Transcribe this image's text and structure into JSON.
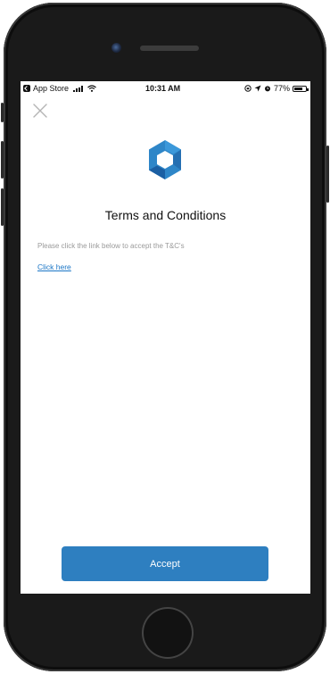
{
  "status_bar": {
    "back_app": "App Store",
    "time": "10:31 AM",
    "battery": "77%",
    "battery_level": 0.77,
    "icons": [
      "back-app-icon",
      "signal-icon",
      "wifi-icon",
      "screen-lock-icon",
      "location-icon",
      "alarm-icon",
      "battery-icon"
    ]
  },
  "header": {
    "close_icon": "close-icon"
  },
  "brand": {
    "logo_icon": "app-logo-icon",
    "logo_colors": [
      "#2e86c8",
      "#1b5fa3"
    ]
  },
  "main": {
    "title": "Terms and Conditions",
    "description": "Please click the link below to accept the T&C's",
    "link_label": "Click here"
  },
  "footer": {
    "accept_label": "Accept",
    "accent_color": "#2e7fc0"
  }
}
